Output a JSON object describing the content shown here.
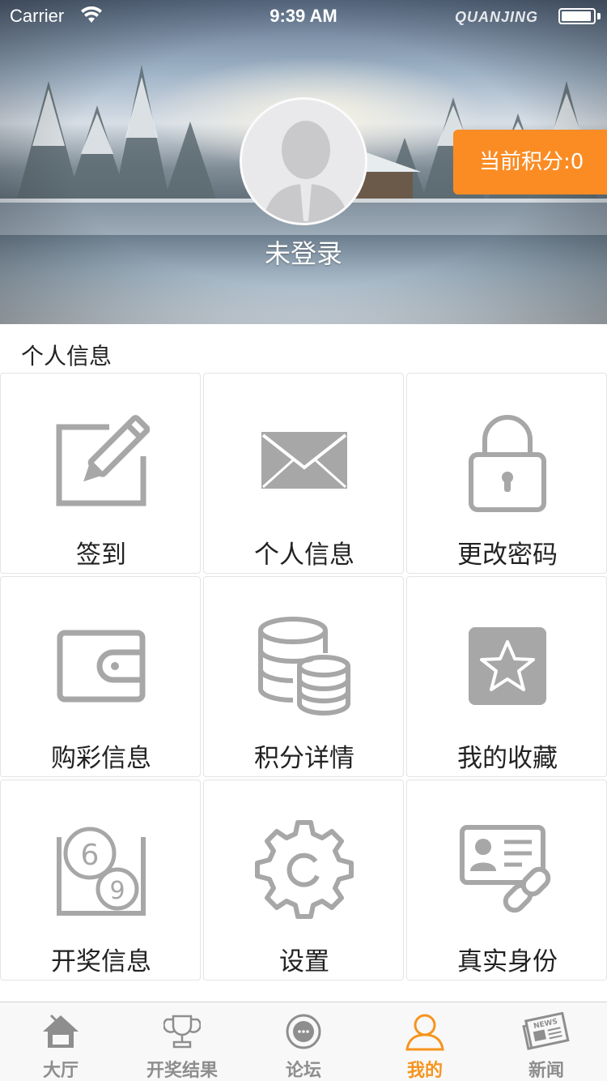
{
  "status_bar": {
    "carrier": "Carrier",
    "time": "9:39 AM",
    "watermark": "QUANJING"
  },
  "profile": {
    "name": "未登录",
    "points_label": "当前积分:0"
  },
  "section": {
    "title": "个人信息"
  },
  "grid": {
    "items": [
      {
        "label": "签到",
        "icon": "edit-icon"
      },
      {
        "label": "个人信息",
        "icon": "envelope-icon"
      },
      {
        "label": "更改密码",
        "icon": "lock-icon"
      },
      {
        "label": "购彩信息",
        "icon": "wallet-icon"
      },
      {
        "label": "积分详情",
        "icon": "coins-icon"
      },
      {
        "label": "我的收藏",
        "icon": "star-icon"
      },
      {
        "label": "开奖信息",
        "icon": "lottery-balls-icon"
      },
      {
        "label": "设置",
        "icon": "gear-icon"
      },
      {
        "label": "真实身份",
        "icon": "id-card-icon"
      }
    ]
  },
  "tabbar": {
    "active_color": "#f6941d",
    "inactive_color": "#8e8e8e",
    "tabs": [
      {
        "label": "大厅",
        "icon": "home-icon"
      },
      {
        "label": "开奖结果",
        "icon": "trophy-icon"
      },
      {
        "label": "论坛",
        "icon": "forum-icon"
      },
      {
        "label": "我的",
        "icon": "user-icon"
      },
      {
        "label": "新闻",
        "icon": "newspaper-icon"
      }
    ]
  },
  "colors": {
    "accent": "#fb8c24",
    "icon_gray": "#a7a7a7"
  }
}
